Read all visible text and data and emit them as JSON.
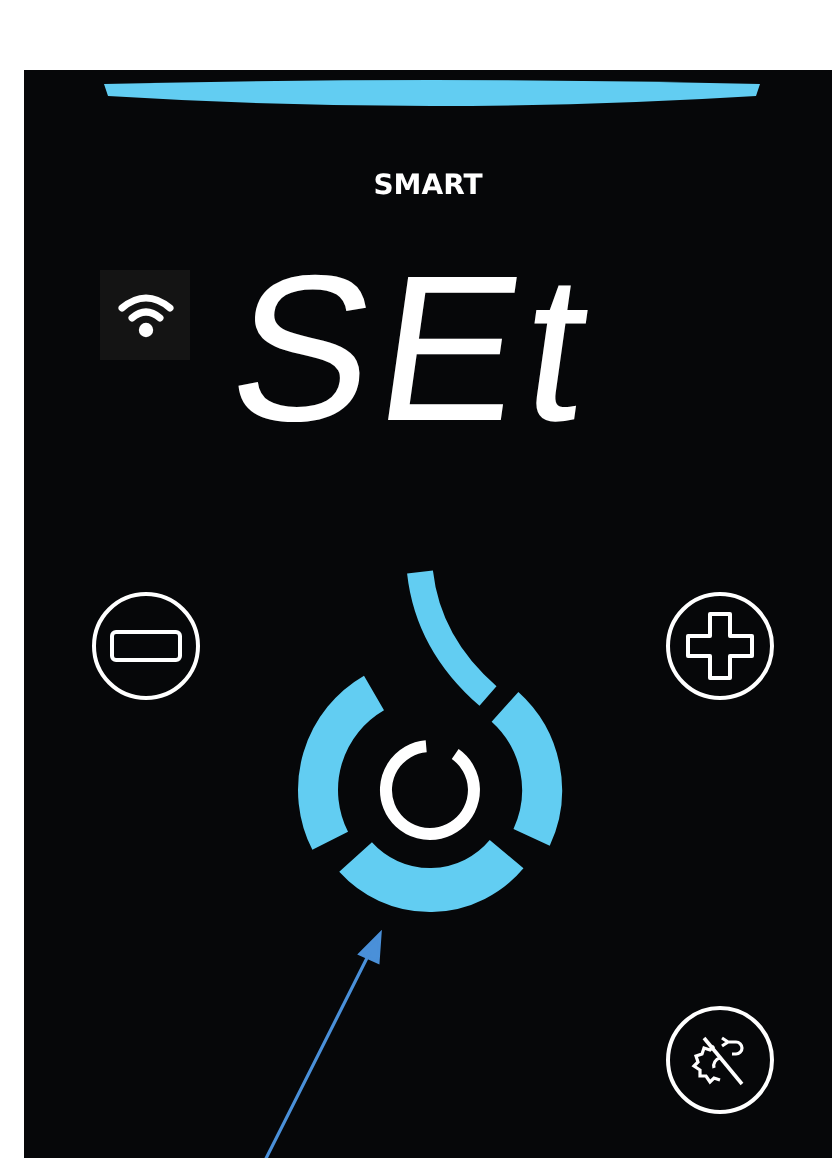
{
  "top_bar": {
    "level": 1
  },
  "mode_label": "SMART",
  "display": "SEt",
  "buttons": [
    {
      "kind": "minus"
    },
    {
      "kind": "plus"
    },
    {
      "kind": "settings-off"
    }
  ]
}
